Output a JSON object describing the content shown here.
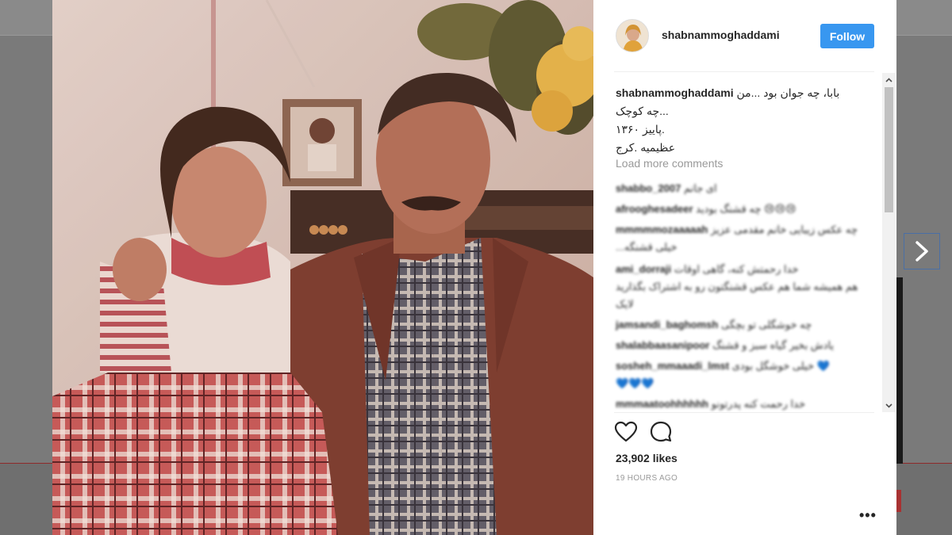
{
  "post": {
    "username": "shabnammoghaddami",
    "follow_label": "Follow",
    "caption": {
      "user": "shabnammoghaddami",
      "line1": "بابا، چه جوان بود ...من",
      "line2": "چه کوچک...",
      "line3": "پاییز ۱۳۶۰.",
      "line4": "عظیمیه .کرج"
    },
    "load_more": "Load more comments",
    "likes": "23,902 likes",
    "time": "19 HOURS AGO"
  },
  "blurred_comments": [
    {
      "user": "shabbo_2007",
      "text": "ای جانم"
    },
    {
      "user": "afrooghesadeer",
      "text": "چه قشنگ بودید 😢😢😢"
    },
    {
      "user": "mmmmmozaaaaah",
      "text": "چه عکس زیبایی خانم مقدمی عزیز"
    },
    {
      "user": "",
      "text": "...خیلی قشنگه"
    },
    {
      "user": "ami_dorraji",
      "text": "خدا رحمتش کنه، گاهی اوقات"
    },
    {
      "user": "",
      "text": "هم همیشه شما هم عکس قشنگتون رو به اشتراک بگذارید"
    },
    {
      "user": "",
      "text": "لایک"
    },
    {
      "user": "jamsandi_baghomsh",
      "text": "چه خوشگلی تو بچگی"
    },
    {
      "user": "shalabbaasanipoor",
      "text": "یادش بخیر گیاه سبز و قشنگ"
    },
    {
      "user": "sosheh_mmaaadi_lmst",
      "text": "خیلی خوشگل بودی 💙"
    },
    {
      "user": "",
      "text": "💙💙💙"
    },
    {
      "user": "mmmaatoohhhhhh",
      "text": "خدا رحمت کنه پدرتونو"
    }
  ],
  "colors": {
    "follow_bg": "#3897f0",
    "accent_red": "#a83232"
  },
  "icons": [
    "heart-icon",
    "comment-icon",
    "chevron-right-icon",
    "more-dots-icon"
  ]
}
